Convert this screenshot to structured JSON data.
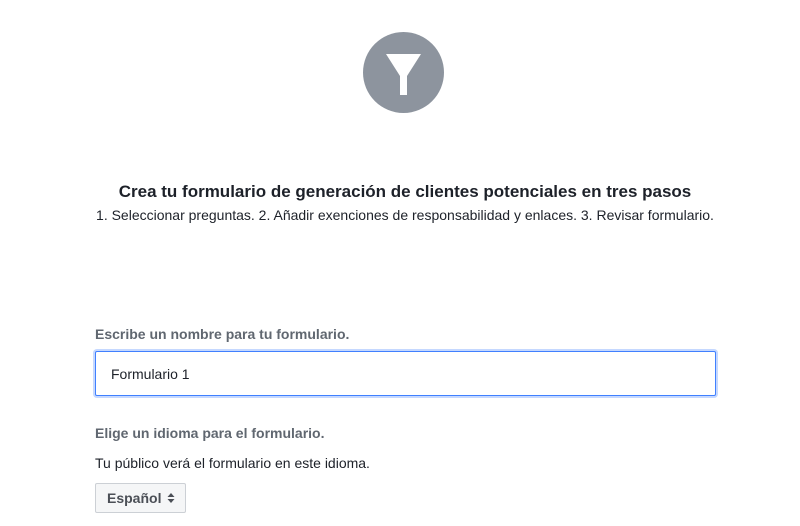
{
  "header": {
    "icon": "filter-icon",
    "icon_color": "#8d949e"
  },
  "intro": {
    "title": "Crea tu formulario de generación de clientes potenciales en tres pasos",
    "steps": "1. Seleccionar preguntas. 2. Añadir exenciones de responsabilidad y enlaces. 3. Revisar formulario."
  },
  "form_name": {
    "label": "Escribe un nombre para tu formulario.",
    "value": "Formulario 1"
  },
  "language": {
    "label": "Elige un idioma para el formulario.",
    "help": "Tu público verá el formulario en este idioma.",
    "selected": "Español",
    "icon": "up-down-arrows-icon"
  },
  "colors": {
    "focus_border": "#4080ff",
    "label_gray": "#606770",
    "text": "#1d2129"
  }
}
